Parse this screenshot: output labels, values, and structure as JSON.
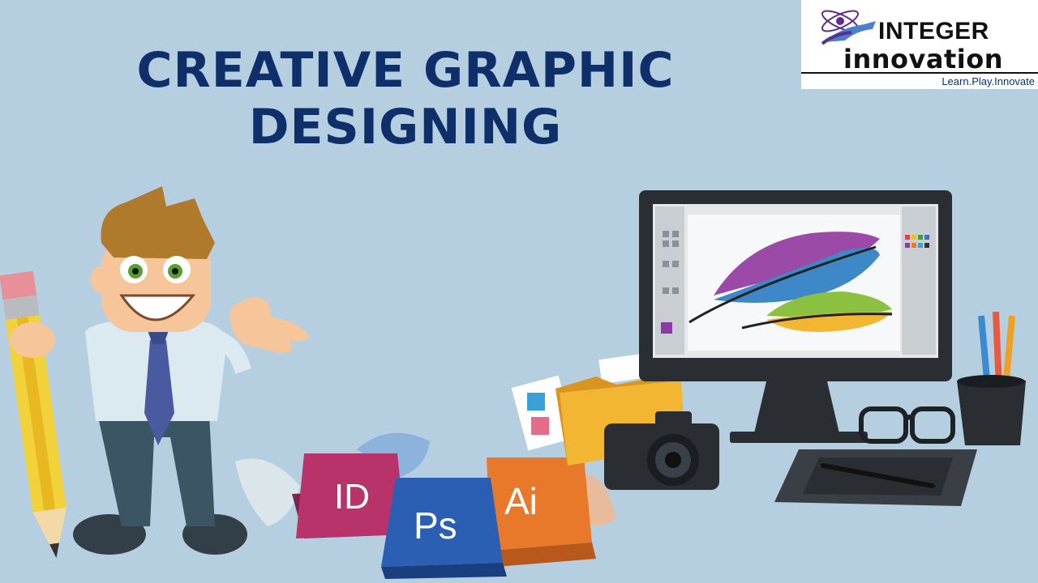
{
  "title": {
    "line1": "CREATIVE GRAPHIC",
    "line2": "DESIGNING"
  },
  "logo": {
    "name_line1": "INTEGER",
    "name_line2": "innovation",
    "tagline": "Learn.Play.Innovate"
  },
  "apps": {
    "indesign": "ID",
    "photoshop": "Ps",
    "illustrator": "Ai"
  },
  "colors": {
    "background": "#b5cfe0",
    "title": "#0f2f6b",
    "indesign": "#b8336a",
    "photoshop": "#2a5fb4",
    "illustrator": "#e8782a",
    "folder": "#f3b632"
  },
  "icons": [
    "atom-logo-icon",
    "pencil-icon",
    "cartoon-designer",
    "monitor-icon",
    "feather-icon",
    "folder-icon",
    "camera-icon",
    "glasses-icon",
    "pen-cup-icon",
    "drawing-tablet-icon"
  ]
}
